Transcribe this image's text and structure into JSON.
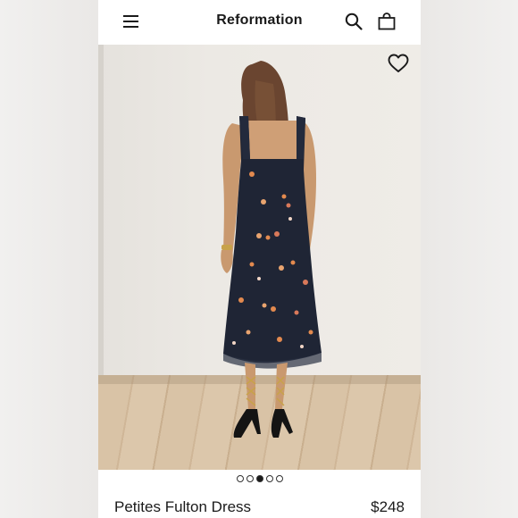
{
  "header": {
    "brand": "Reformation",
    "icons": [
      "menu-icon",
      "search-icon",
      "bag-icon"
    ]
  },
  "gallery": {
    "icons": [
      "heart-icon"
    ],
    "dot_count": 5,
    "active_index": 2
  },
  "product": {
    "name": "Petites Fulton Dress",
    "price": "$248"
  },
  "colors": {
    "text": "#1a1a1a",
    "dress": "#1f2535",
    "background": "#ffffff"
  }
}
